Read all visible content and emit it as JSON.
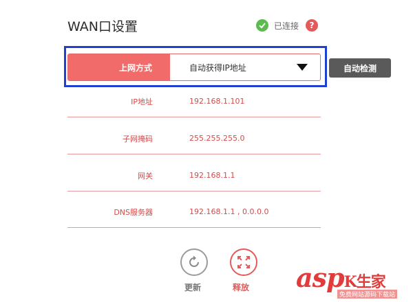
{
  "header": {
    "title": "WAN口设置",
    "status_text": "已连接",
    "help_glyph": "?"
  },
  "wan": {
    "label": "上网方式",
    "mode_value": "自动获得IP地址",
    "detect_button": "自动检测"
  },
  "fields": [
    {
      "key": "IP地址",
      "value": "192.168.1.101"
    },
    {
      "key": "子网掩码",
      "value": "255.255.255.0"
    },
    {
      "key": "网关",
      "value": "192.168.1.1"
    },
    {
      "key": "DNS服务器",
      "value": "192.168.1.1 , 0.0.0.0"
    }
  ],
  "actions": {
    "refresh_label": "更新",
    "release_label": "释放"
  },
  "watermark": {
    "brand": "asp",
    "brand2": "K生家",
    "sub": "免费网站源码下载站"
  },
  "colors": {
    "accent": "#f26b6b",
    "status_ok": "#5cbb4e",
    "focus_border": "#1f3fd0",
    "detect_bg": "#5a5a5a"
  },
  "icons": [
    "check-circle-icon",
    "help-icon",
    "dropdown-caret-icon",
    "refresh-icon",
    "release-arrows-icon"
  ]
}
